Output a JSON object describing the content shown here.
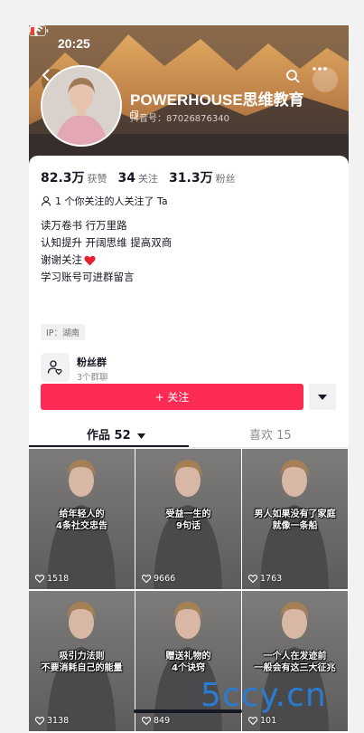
{
  "status_bar": {
    "time": "20:25"
  },
  "profile": {
    "name": "POWERHOUSE思维教育",
    "douyin_id": "抖音号：87026876340"
  },
  "stats": [
    {
      "value": "82.3万",
      "label": "获赞"
    },
    {
      "value": "34",
      "label": "关注"
    },
    {
      "value": "31.3万",
      "label": "粉丝"
    }
  ],
  "follow_note": "1 个你关注的人关注了 Ta",
  "bio": [
    "读万卷书  行万里路",
    "认知提升  开阔思维  提高双商",
    "谢谢关注",
    "学习账号可进群留言"
  ],
  "ip_tag": "IP：湖南",
  "fan_group": {
    "title": "粉丝群",
    "subtitle": "3个群聊"
  },
  "follow_button": "+ 关注",
  "tabs": {
    "works": "作品 52",
    "likes": "喜欢 15"
  },
  "videos": [
    {
      "caption": "给年轻人的\n4条社交忠告",
      "likes": "1518"
    },
    {
      "caption": "受益一生的\n9句话",
      "likes": "9666"
    },
    {
      "caption": "男人如果没有了家庭\n就像一条船",
      "likes": "1763"
    },
    {
      "caption": "吸引力法则\n不要消耗自己的能量",
      "likes": "3138"
    },
    {
      "caption": "赠送礼物的\n4个诀窍",
      "likes": "849"
    },
    {
      "caption": "一个人在发迹前\n一般会有这三大征兆",
      "likes": "101"
    }
  ],
  "watermark": "5ccy.cn",
  "colors": {
    "accent": "#fe2c55",
    "text": "#161823",
    "secondary": "#6b6d75"
  }
}
